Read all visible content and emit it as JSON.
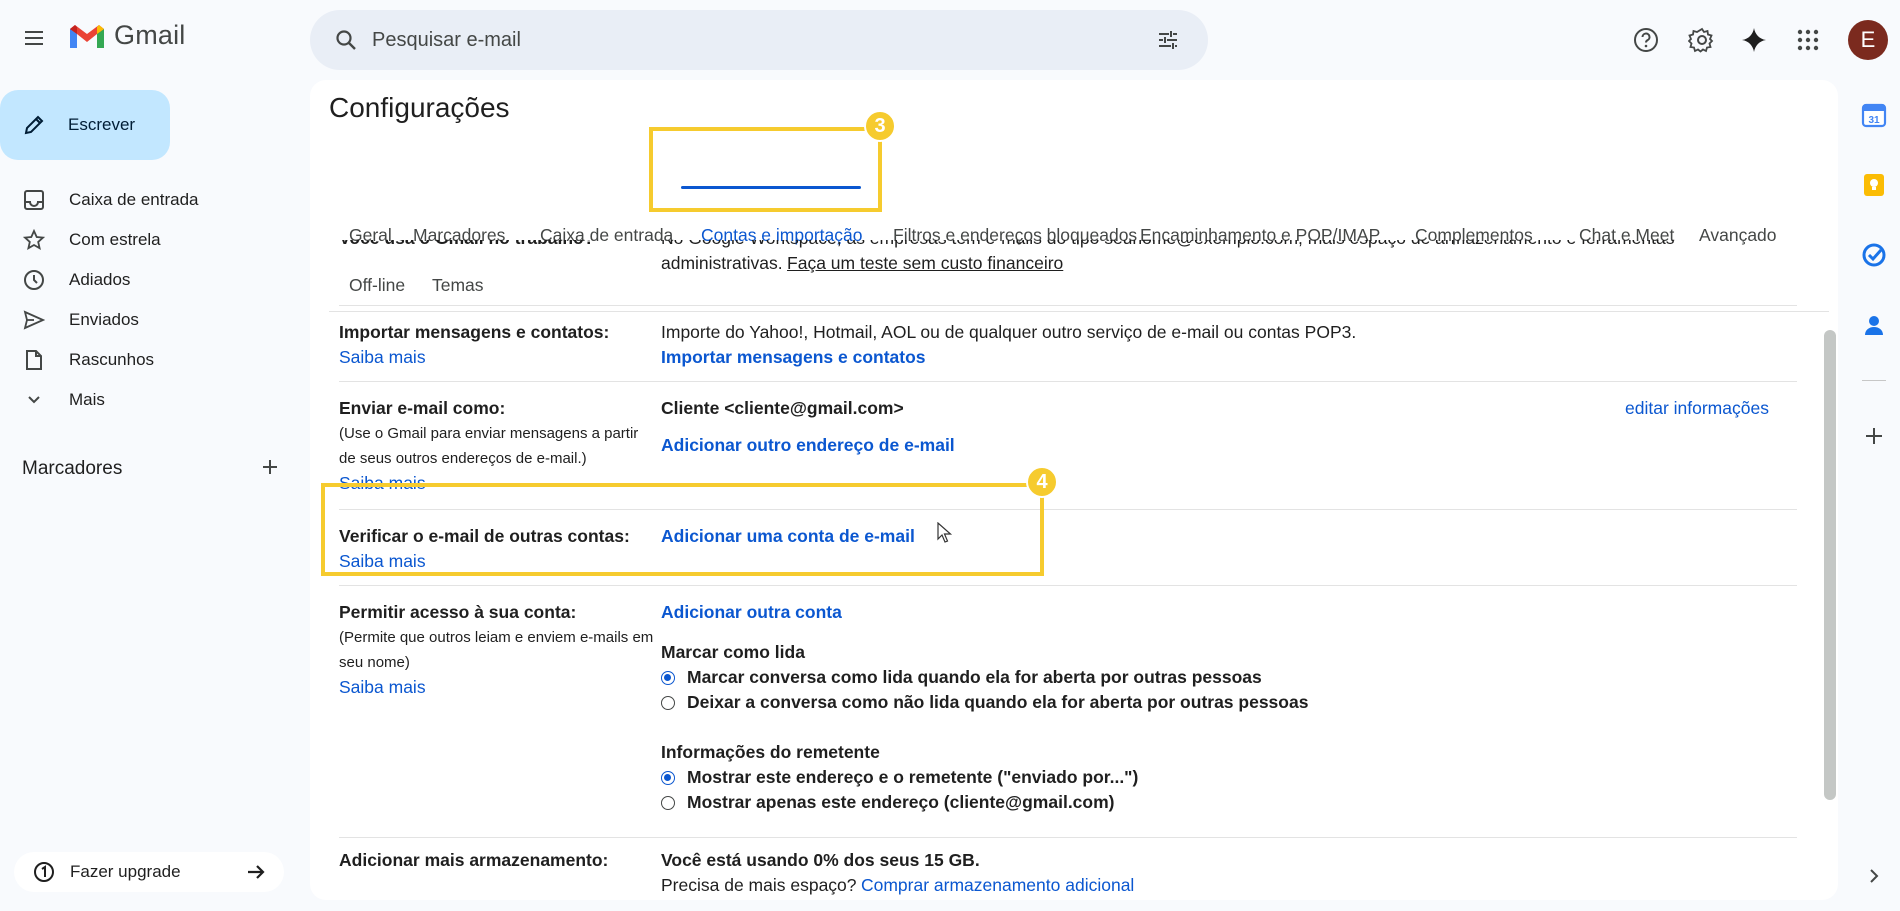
{
  "header": {
    "app_name": "Gmail",
    "search_placeholder": "Pesquisar e-mail",
    "avatar_letter": "E"
  },
  "compose_label": "Escrever",
  "nav": {
    "items": [
      {
        "label": "Caixa de entrada",
        "icon": "inbox-icon"
      },
      {
        "label": "Com estrela",
        "icon": "star-icon"
      },
      {
        "label": "Adiados",
        "icon": "clock-icon"
      },
      {
        "label": "Enviados",
        "icon": "send-icon"
      },
      {
        "label": "Rascunhos",
        "icon": "draft-icon"
      },
      {
        "label": "Mais",
        "icon": "chevron-down-icon"
      }
    ],
    "labels_heading": "Marcadores",
    "upgrade_label": "Fazer upgrade"
  },
  "settings": {
    "title": "Configurações",
    "tabs": [
      "Geral",
      "Marcadores",
      "Caixa de entrada",
      "Contas e importação",
      "Filtros e endereços bloqueados",
      "Encaminhamento e POP/IMAP",
      "Complementos",
      "Chat e Meet",
      "Avançado",
      "Off-line",
      "Temas"
    ],
    "active_tab": "Contas e importação",
    "rows": {
      "workspace": {
        "label": "Você usa o Gmail no trabalho?",
        "text1": "No Google Workspace, as empresas têm e-mails do tipo seunome@exemplo.com, mais espaço de armazenamento e ferramentas",
        "text2": "administrativas.",
        "link": "Faça um teste sem custo financeiro"
      },
      "import": {
        "label": "Importar mensagens e contatos:",
        "learn_more": "Saiba mais",
        "text": "Importe do Yahoo!, Hotmail, AOL ou de qualquer outro serviço de e-mail ou contas POP3.",
        "action": "Importar mensagens e contatos"
      },
      "send_as": {
        "label": "Enviar e-mail como:",
        "desc1": "(Use o Gmail para enviar mensagens a partir",
        "desc2": "de seus outros endereços de e-mail.)",
        "learn_more": "Saiba mais",
        "address": "Cliente <cliente@gmail.com>",
        "edit": "editar informações",
        "action": "Adicionar outro endereço de e-mail"
      },
      "check_mail": {
        "label": "Verificar o e-mail de outras contas:",
        "learn_more": "Saiba mais",
        "action": "Adicionar uma conta de e-mail"
      },
      "grant_access": {
        "label": "Permitir acesso à sua conta:",
        "desc1": "(Permite que outros leiam e enviem e-mails em",
        "desc2": "seu nome)",
        "learn_more": "Saiba mais",
        "action": "Adicionar outra conta",
        "mark_read_heading": "Marcar como lida",
        "mark_read_option1": "Marcar conversa como lida quando ela for aberta por outras pessoas",
        "mark_read_option2": "Deixar a conversa como não lida quando ela for aberta por outras pessoas",
        "sender_heading": "Informações do remetente",
        "sender_option1": "Mostrar este endereço e o remetente (\"enviado por...\")",
        "sender_option2": "Mostrar apenas este endereço (cliente@gmail.com)"
      },
      "storage": {
        "label": "Adicionar mais armazenamento:",
        "usage": "Você está usando 0% dos seus 15 GB.",
        "need_more": "Precisa de mais espaço?",
        "buy": "Comprar armazenamento adicional"
      }
    }
  },
  "annotations": {
    "badge_tab": "3",
    "badge_row": "4",
    "color": "#f6cb2e"
  }
}
